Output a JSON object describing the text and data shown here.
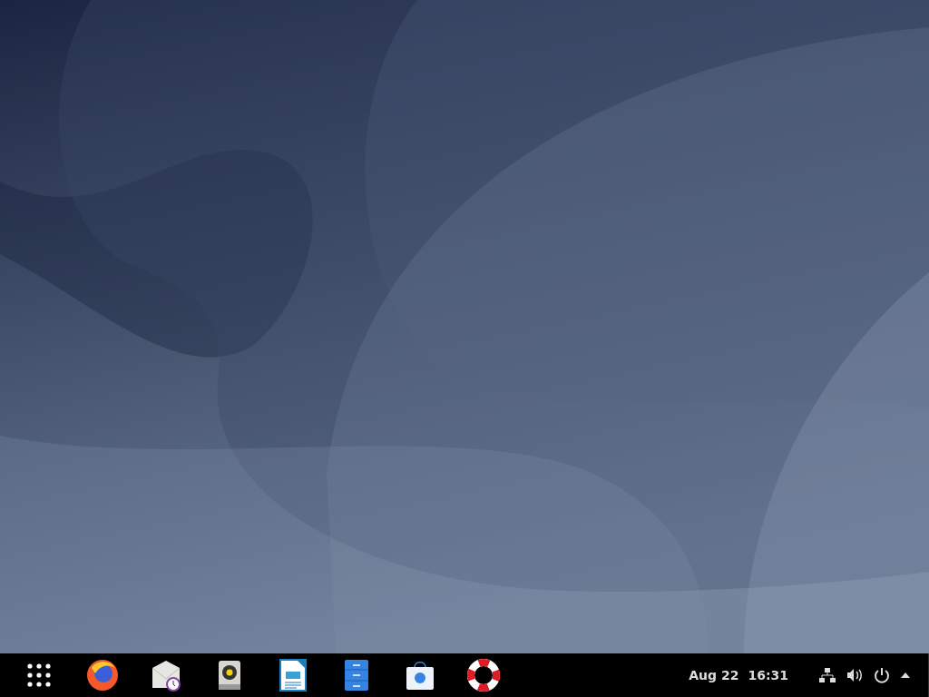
{
  "taskbar": {
    "clock": {
      "date": "Aug 22",
      "time": "16:31"
    }
  }
}
